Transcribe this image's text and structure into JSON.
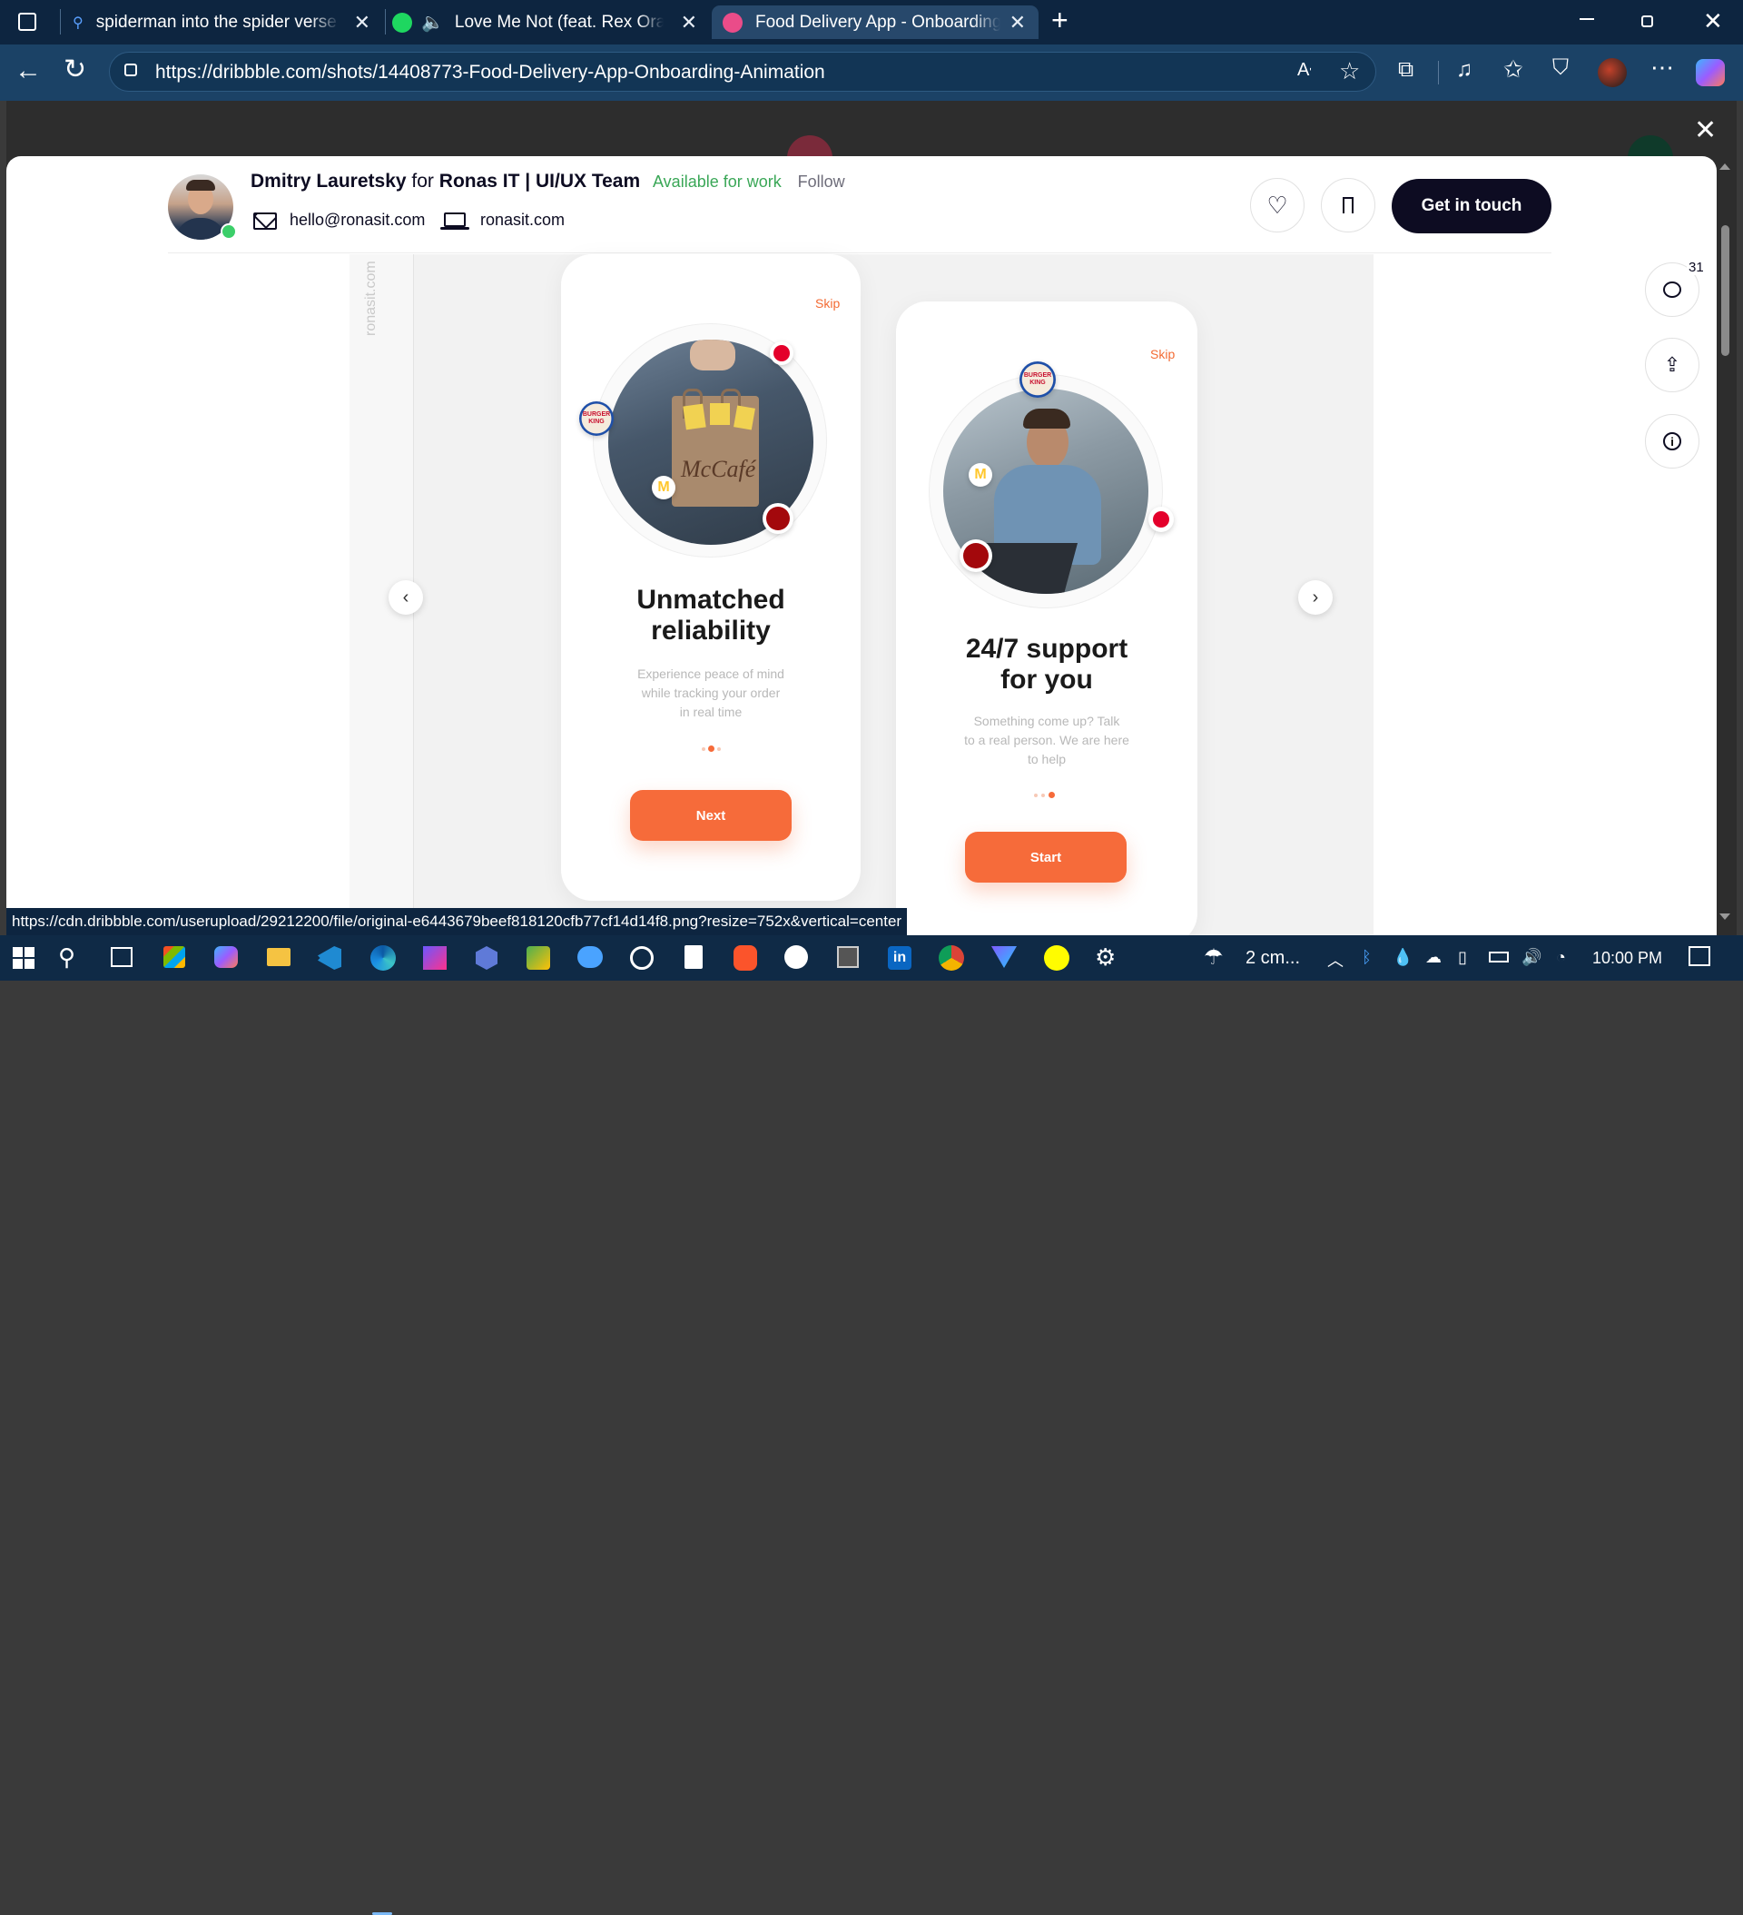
{
  "browser": {
    "tabs": [
      {
        "title": "spiderman into the spider verse s"
      },
      {
        "title": "Love Me Not (feat. Rex Orang"
      },
      {
        "title": "Food Delivery App - Onboarding"
      }
    ],
    "url": "https://dribbble.com/shots/14408773-Food-Delivery-App-Onboarding-Animation",
    "status_url": "https://cdn.dribbble.com/userupload/29212200/file/original-e6443679beef818120cfb77cf14d14f8.png?resize=752x&vertical=center"
  },
  "header": {
    "author": "Dmitry Lauretsky",
    "for_text": "for",
    "team": "Ronas IT | UI/UX Team",
    "availability": "Available for work",
    "follow": "Follow",
    "email": "hello@ronasit.com",
    "website": "ronasit.com",
    "cta": "Get in touch"
  },
  "sidebar": {
    "comments_count": "31"
  },
  "shot": {
    "watermark": "ronasit.com",
    "screen1": {
      "skip": "Skip",
      "title_line1": "Unmatched",
      "title_line2": "reliability",
      "desc_line1": "Experience peace of mind",
      "desc_line2": "while tracking your order",
      "desc_line3": "in real time",
      "button": "Next",
      "bag_text": "McCafé"
    },
    "screen2": {
      "skip": "Skip",
      "title_line1": "24/7 support",
      "title_line2": "for you",
      "desc_line1": "Something come up? Talk",
      "desc_line2": "to a real person. We are here",
      "desc_line3": "to help",
      "button": "Start"
    },
    "badge_bk": "BURGER KING",
    "badge_m": "M"
  },
  "taskbar": {
    "weather": "2 cm...",
    "clock": "10:00 PM"
  },
  "colors": {
    "accent_orange": "#f66b3a",
    "available_green": "#3aa757",
    "tabbar": "#0d2540"
  }
}
